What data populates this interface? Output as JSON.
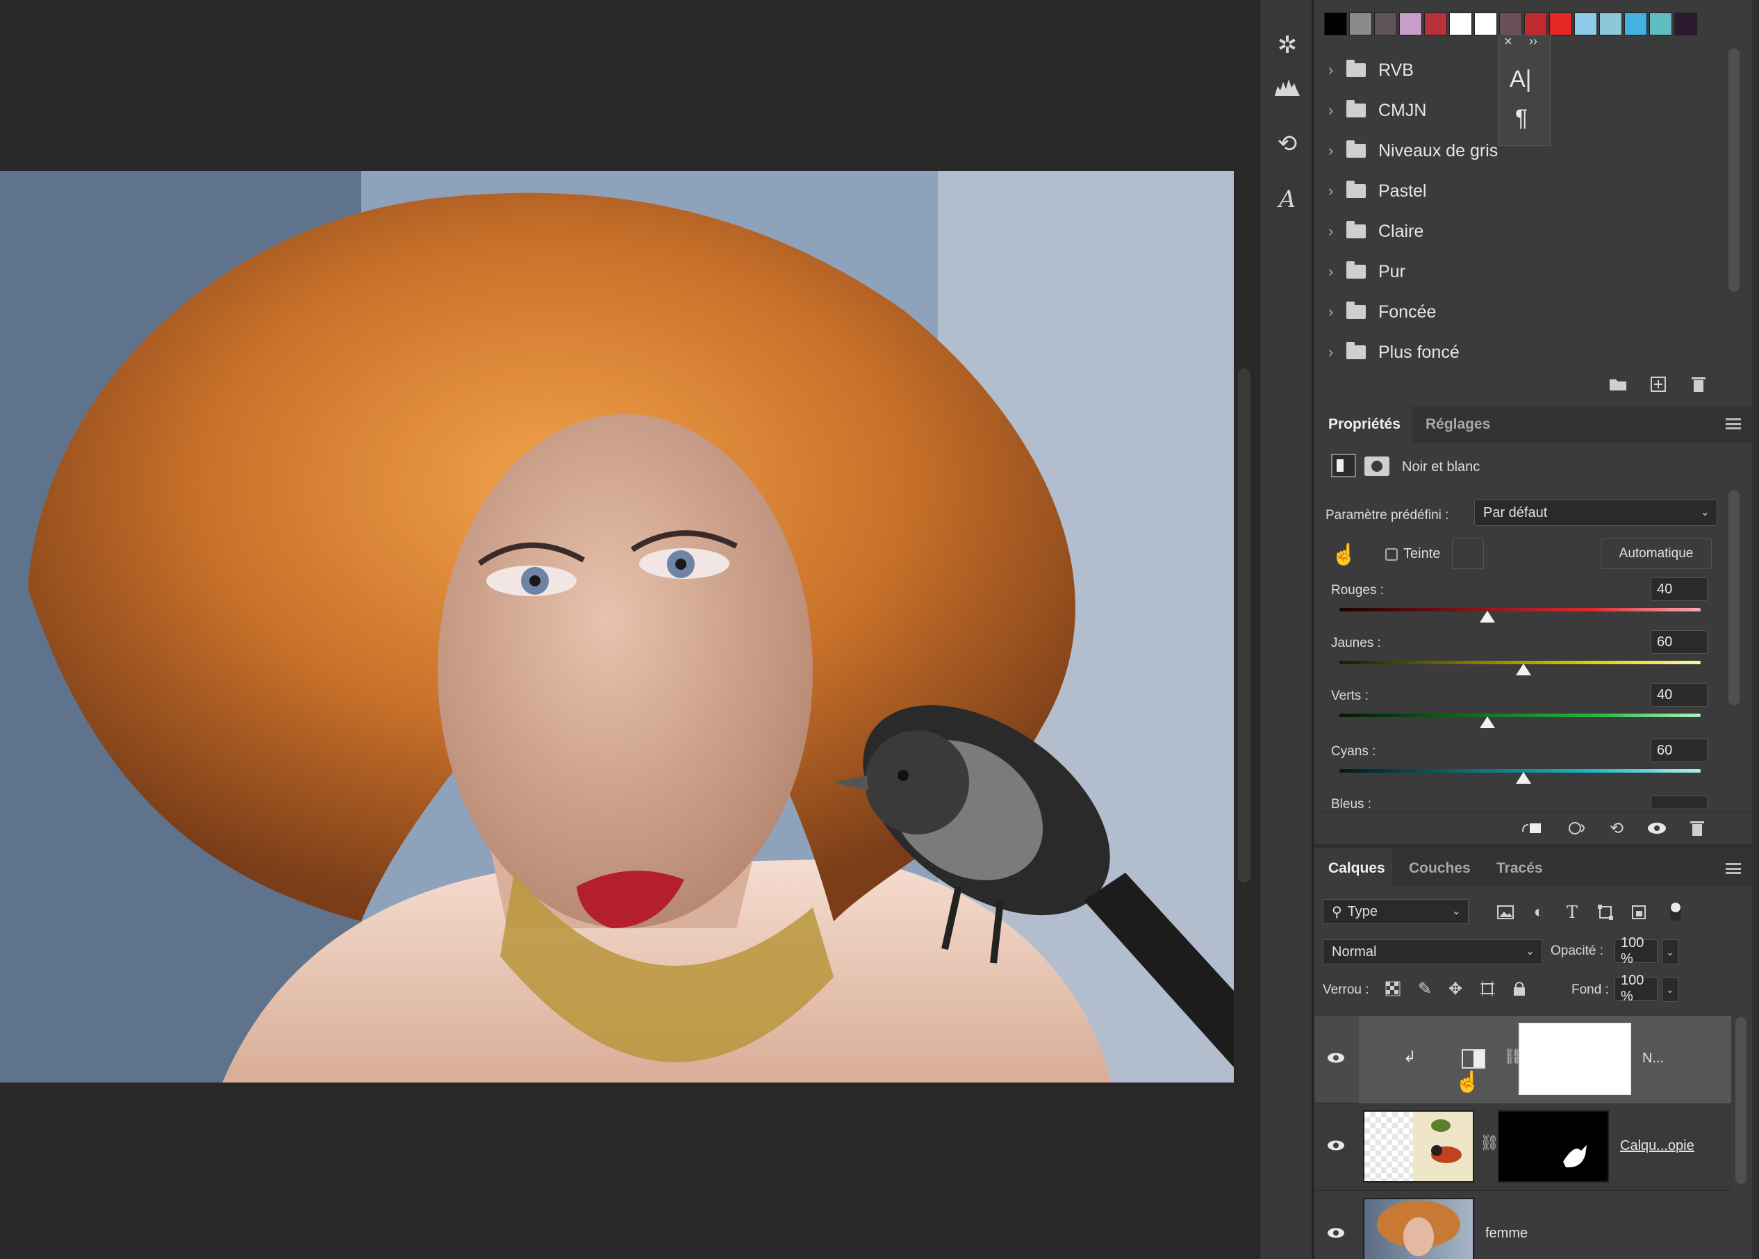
{
  "swatches": [
    "#000000",
    "#8b8b8b",
    "#5e5358",
    "#c79ec9",
    "#b8313c",
    "#ffffff",
    "#ffffff",
    "#6b5057",
    "#c02a2f",
    "#e42724",
    "#8fcbe8",
    "#8cc8d8",
    "#43b2e3",
    "#5fbcc2",
    "#2b1a30"
  ],
  "swatch_folders": [
    "RVB",
    "CMJN",
    "Niveaux de gris",
    "Pastel",
    "Claire",
    "Pur",
    "Foncée",
    "Plus foncé"
  ],
  "char_popup": {
    "close": "×",
    "expand": "››",
    "char_icon": "A|",
    "para_icon": "¶"
  },
  "properties": {
    "tab_active": "Propriétés",
    "tab_inactive": "Réglages",
    "adjustment_name": "Noir et blanc",
    "preset_label": "Paramètre prédéfini :",
    "preset_value": "Par défaut",
    "tint_label": "Teinte",
    "auto_button": "Automatique",
    "sliders": [
      {
        "label": "Rouges :",
        "value": "40",
        "level": 0.41
      },
      {
        "label": "Jaunes :",
        "value": "60",
        "level": 0.51
      },
      {
        "label": "Verts :",
        "value": "40",
        "level": 0.41
      },
      {
        "label": "Cyans :",
        "value": "60",
        "level": 0.51
      },
      {
        "label": "Bleus :",
        "value": "",
        "level": null
      }
    ]
  },
  "layers": {
    "tab_active": "Calques",
    "tab_2": "Couches",
    "tab_3": "Tracés",
    "filter_value": "Type",
    "blend_mode": "Normal",
    "opacity_label": "Opacité :",
    "opacity_value": "100 %",
    "lock_label": "Verrou :",
    "fill_label": "Fond :",
    "fill_value": "100 %",
    "rows": [
      {
        "name": "N...",
        "selected": true
      },
      {
        "name": "Calqu...opie",
        "selected": false
      },
      {
        "name": "femme",
        "selected": false
      }
    ]
  },
  "colors": {
    "panel": "#3b3b3b",
    "canvas_bg": "#282828",
    "dock": "#383838"
  }
}
